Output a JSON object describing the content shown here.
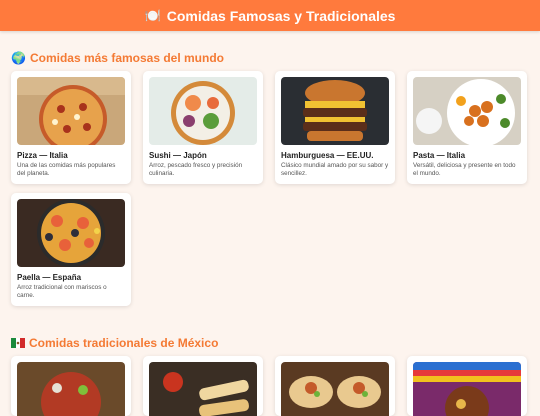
{
  "header": {
    "icon": "plate-icon",
    "title": "Comidas Famosas y Tradicionales"
  },
  "sections": [
    {
      "icon": "globe-icon",
      "title": "Comidas más famosas del mundo",
      "cards": [
        {
          "name": "Pizza — Italia",
          "desc": "Una de las comidas más populares del planeta."
        },
        {
          "name": "Sushi — Japón",
          "desc": "Arroz, pescado fresco y precisión culinaria."
        },
        {
          "name": "Hamburguesa — EE.UU.",
          "desc": "Clásico mundial amado por su sabor y sencillez."
        },
        {
          "name": "Pasta — Italia",
          "desc": "Versátil, deliciosa y presente en todo el mundo."
        },
        {
          "name": "Paella — España",
          "desc": "Arroz tradicional con mariscos o carne."
        }
      ]
    },
    {
      "icon": "mexico-flag-icon",
      "title": "Comidas tradicionales de México",
      "cards": []
    }
  ],
  "colors": {
    "accent": "#ff7a3d",
    "background": "#fdf4ee",
    "section_title": "#f47a34"
  }
}
